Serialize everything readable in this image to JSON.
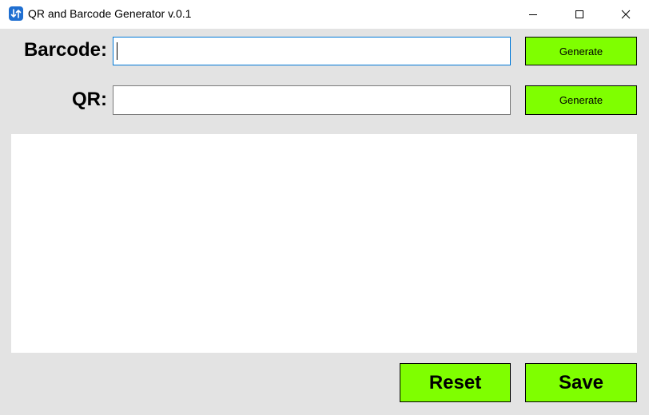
{
  "window": {
    "title": "QR and Barcode Generator v.0.1",
    "icon": "app-icon",
    "controls": [
      "minimize-icon",
      "maximize-icon",
      "close-icon"
    ]
  },
  "form": {
    "barcode_label": "Barcode:",
    "barcode_value": "",
    "qr_label": "QR:",
    "qr_value": "",
    "generate_barcode_label": "Generate",
    "generate_qr_label": "Generate"
  },
  "actions": {
    "reset_label": "Reset",
    "save_label": "Save"
  },
  "colors": {
    "button_bg": "#7fff00",
    "window_bg": "#e3e3e3",
    "focus_border": "#0078d7"
  }
}
